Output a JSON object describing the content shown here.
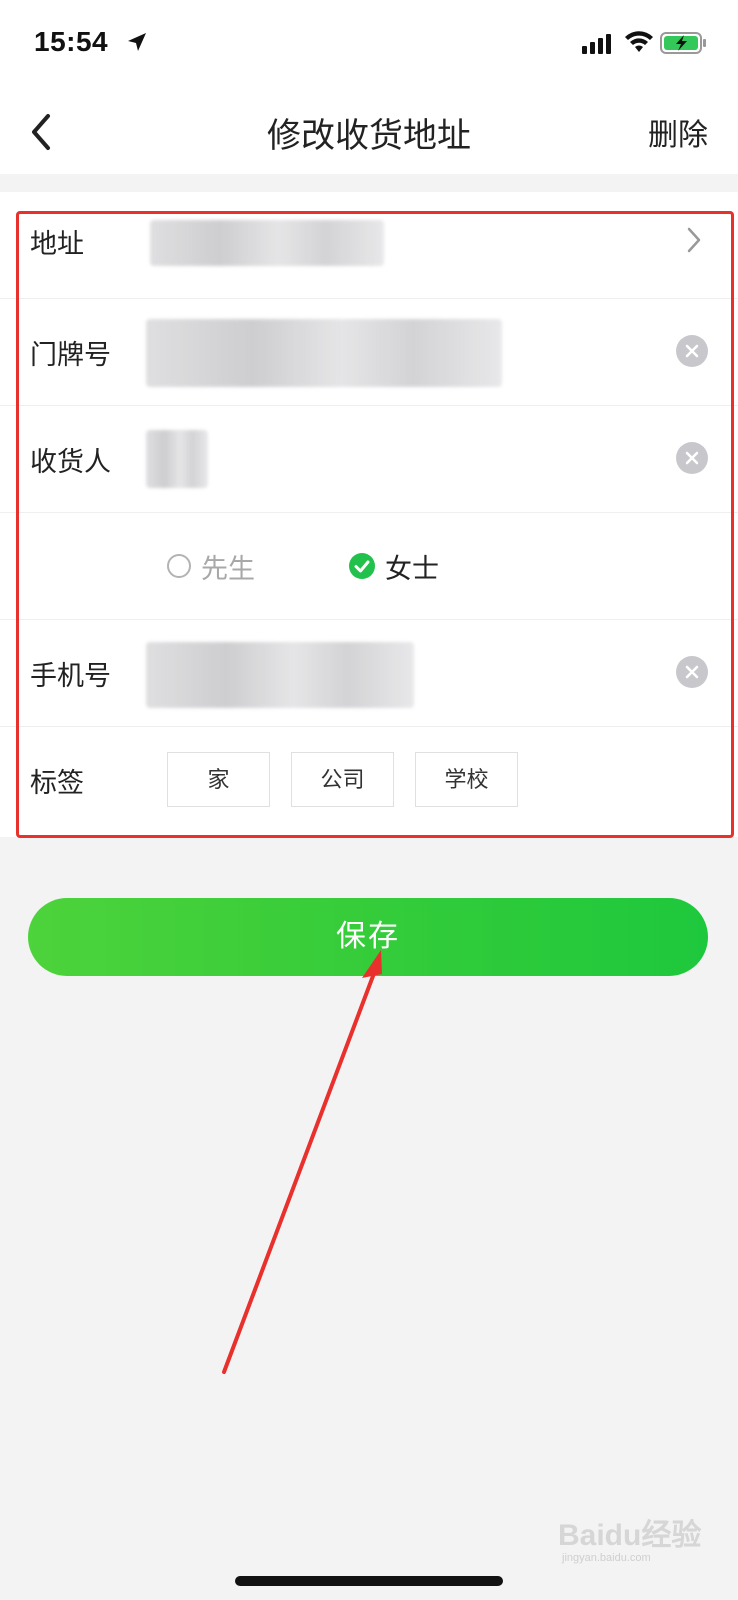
{
  "status_bar": {
    "time": "15:54",
    "icons": [
      "location-arrow-icon",
      "cellular-signal-icon",
      "wifi-icon",
      "battery-charging-icon"
    ]
  },
  "nav": {
    "back_icon": "chevron-left-icon",
    "title": "修改收货地址",
    "delete_label": "删除"
  },
  "form": {
    "address_label": "地址",
    "doorplate_label": "门牌号",
    "receiver_label": "收货人",
    "gender": {
      "options": [
        "先生",
        "女士"
      ],
      "selected": "女士"
    },
    "phone_label": "手机号",
    "tags_label": "标签",
    "tags": [
      "家",
      "公司",
      "学校"
    ]
  },
  "save_label": "保存",
  "colors": {
    "accent_green": "#21c14b",
    "annotation_red": "#e8302d"
  },
  "watermark": {
    "brand": "Baidu经验",
    "sub": "jingyan.baidu.com"
  }
}
